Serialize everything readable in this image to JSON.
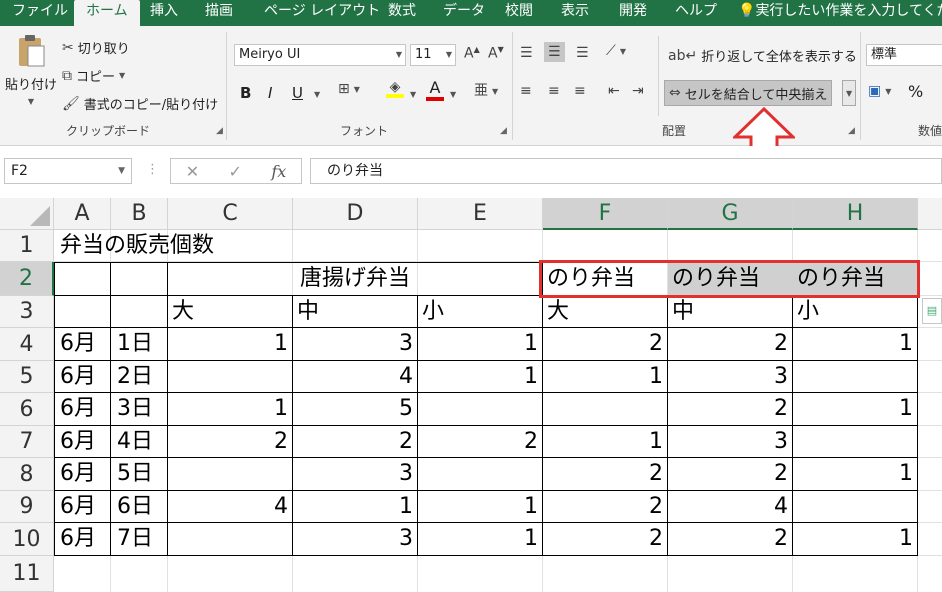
{
  "tabs": [
    "ファイル",
    "ホーム",
    "挿入",
    "描画",
    "ページ レイアウト",
    "数式",
    "データ",
    "校閲",
    "表示",
    "開発",
    "ヘルプ"
  ],
  "tell_me": "実行したい作業を入力してくださ",
  "ribbon": {
    "clipboard": {
      "paste": "貼り付け",
      "cut": "切り取り",
      "copy": "コピー",
      "format_painter": "書式のコピー/貼り付け",
      "label": "クリップボード"
    },
    "font": {
      "name": "Meiryo UI",
      "size": "11",
      "label": "フォント",
      "bold": "B",
      "italic": "I",
      "underline": "U",
      "font_color_letter": "A"
    },
    "alignment": {
      "wrap_text": "折り返して全体を表示する",
      "merge_center": "セルを結合して中央揃え",
      "label": "配置"
    },
    "number": {
      "format": "標準",
      "percent": "%",
      "label": "数値"
    }
  },
  "formula_bar": {
    "name_box": "F2",
    "fx": "fx",
    "content": "のり弁当"
  },
  "columns": [
    "A",
    "B",
    "C",
    "D",
    "E",
    "F",
    "G",
    "H"
  ],
  "rows": [
    "1",
    "2",
    "3",
    "4",
    "5",
    "6",
    "7",
    "8",
    "9",
    "10",
    "11"
  ],
  "cells": {
    "A1": "弁当の販売個数",
    "C2": "唐揚げ弁当",
    "F2": "のり弁当",
    "G2": "のり弁当",
    "H2": "のり弁当",
    "C3": "大",
    "D3": "中",
    "E3": "小",
    "F3": "大",
    "G3": "中",
    "H3": "小",
    "data": [
      {
        "a": "6月",
        "b": "1日",
        "c": "1",
        "d": "3",
        "e": "1",
        "f": "2",
        "g": "2",
        "h": "1"
      },
      {
        "a": "6月",
        "b": "2日",
        "c": "",
        "d": "4",
        "e": "1",
        "f": "1",
        "g": "3",
        "h": ""
      },
      {
        "a": "6月",
        "b": "3日",
        "c": "1",
        "d": "5",
        "e": "",
        "f": "",
        "g": "2",
        "h": "1"
      },
      {
        "a": "6月",
        "b": "4日",
        "c": "2",
        "d": "2",
        "e": "2",
        "f": "1",
        "g": "3",
        "h": ""
      },
      {
        "a": "6月",
        "b": "5日",
        "c": "",
        "d": "3",
        "e": "",
        "f": "2",
        "g": "2",
        "h": "1"
      },
      {
        "a": "6月",
        "b": "6日",
        "c": "4",
        "d": "1",
        "e": "1",
        "f": "2",
        "g": "4",
        "h": ""
      },
      {
        "a": "6月",
        "b": "7日",
        "c": "",
        "d": "3",
        "e": "1",
        "f": "2",
        "g": "2",
        "h": "1"
      }
    ]
  },
  "colors": {
    "excel_green": "#217346",
    "highlight_red": "#e03030",
    "selection_gray": "#d0d0d0"
  }
}
